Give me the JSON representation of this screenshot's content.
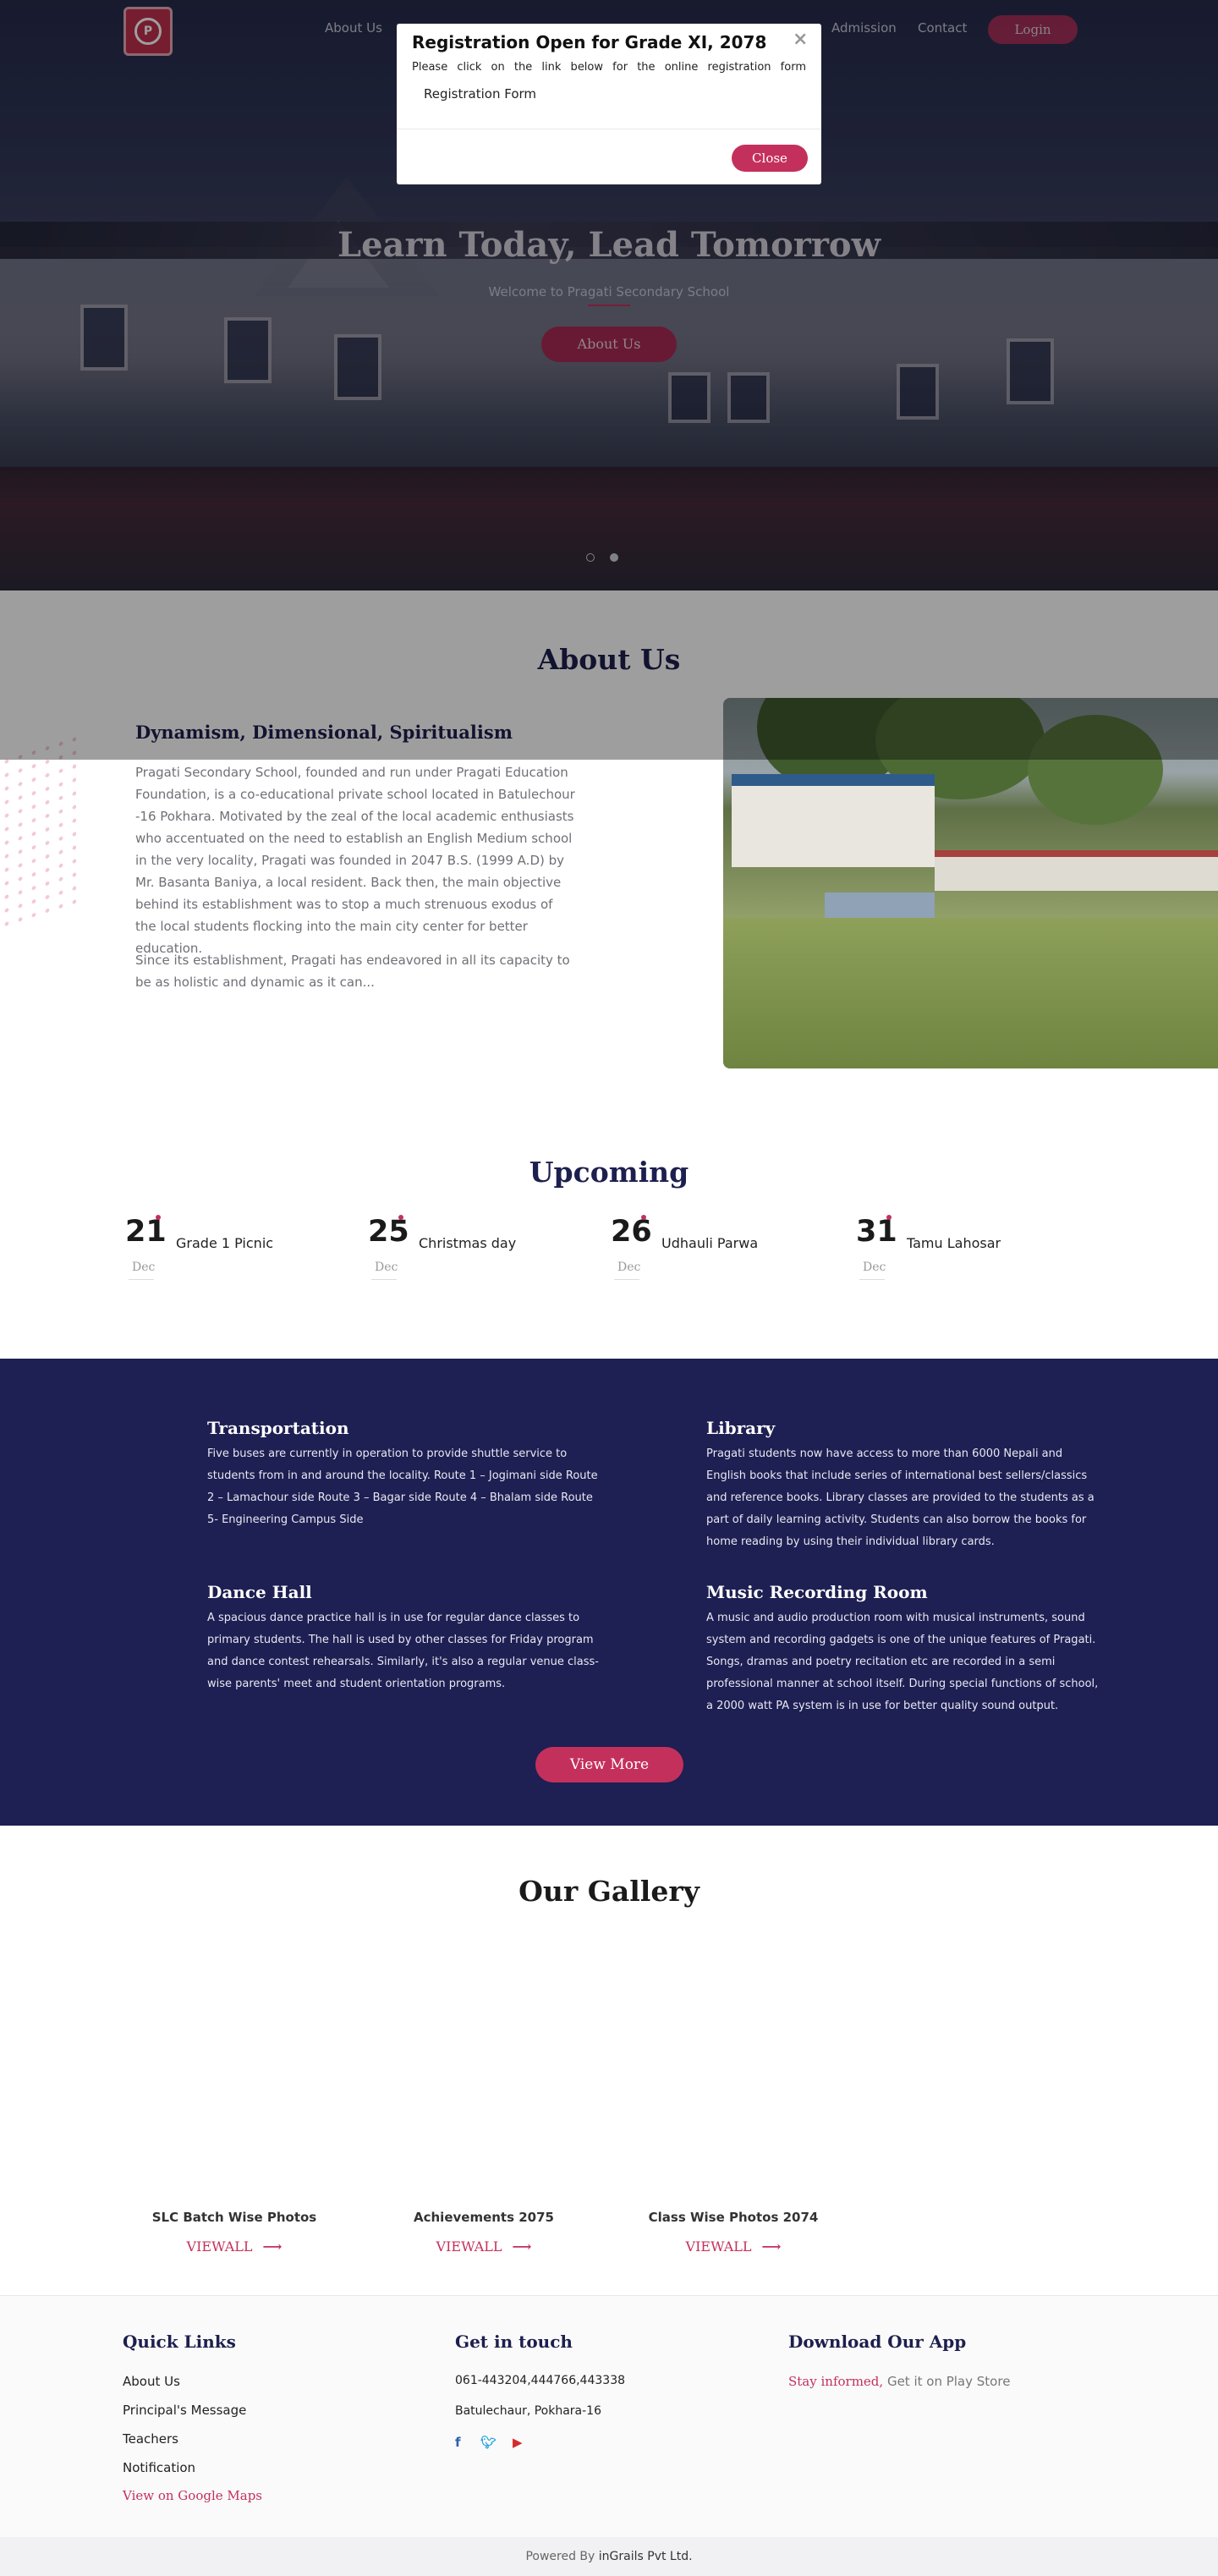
{
  "nav": {
    "links": [
      "About Us",
      "Admission",
      "Contact"
    ],
    "login": "Login"
  },
  "hero": {
    "title": "Learn Today, Lead Tomorrow",
    "subtitle": "Welcome to Pragati Secondary School",
    "button": "About Us"
  },
  "modal": {
    "title": "Registration Open for Grade XI, 2078",
    "close_x": "×",
    "text": "Please click on the link below for the online registration form",
    "link": "Registration Form",
    "close_button": "Close"
  },
  "about": {
    "title": "About Us",
    "subtitle": "Dynamism, Dimensional, Spiritualism",
    "p1": "Pragati Secondary School, founded and run under Pragati Education Foundation, is a co-educational private school located in Batulechour -16 Pokhara. Motivated by the zeal of the local academic enthusiasts who accentuated on the need to establish an English Medium school in the very locality, Pragati was founded in 2047 B.S. (1999 A.D) by Mr. Basanta Baniya, a local resident. Back then, the main objective behind its establishment was to stop a much strenuous exodus of the local students flocking into the main city center for better education.",
    "p2": "Since its establishment, Pragati has endeavored in all its capacity to be as holistic and dynamic as it can..."
  },
  "upcoming": {
    "title": "Upcoming",
    "events": [
      {
        "day": "21",
        "month": "Dec",
        "name": "Grade 1 Picnic"
      },
      {
        "day": "25",
        "month": "Dec",
        "name": "Christmas day"
      },
      {
        "day": "26",
        "month": "Dec",
        "name": "Udhauli Parwa"
      },
      {
        "day": "31",
        "month": "Dec",
        "name": "Tamu Lahosar"
      }
    ]
  },
  "facilities": {
    "items": [
      {
        "title": "Transportation",
        "text": "Five buses are currently in operation to provide shuttle service to students from in and around the locality. Route 1 – Jogimani side Route 2 – Lamachour side Route 3 – Bagar side Route 4 – Bhalam side Route 5- Engineering Campus Side"
      },
      {
        "title": "Library",
        "text": "Pragati students now have access to more than 6000 Nepali and English books that include series of international best sellers/classics and reference books. Library classes are provided to the students as a part of daily learning activity. Students can also borrow the books for home reading by using their individual library cards."
      },
      {
        "title": "Dance Hall",
        "text": "A spacious dance practice hall is in use for regular dance classes to primary students. The hall is used by other classes for Friday program and dance contest rehearsals. Similarly, it's also a regular venue class-wise parents' meet and student orientation programs."
      },
      {
        "title": "Music Recording Room",
        "text": "A music and audio production room with musical instruments, sound system and recording gadgets is one of the unique features of Pragati. Songs, dramas and poetry recitation etc are recorded in a semi professional manner at school itself. During special functions of school, a 2000 watt PA system is in use for better quality sound output."
      }
    ],
    "button": "View More"
  },
  "gallery": {
    "title": "Our Gallery",
    "albums": [
      {
        "name": "SLC Batch Wise Photos",
        "link": "VIEWALL"
      },
      {
        "name": "Achievements 2075",
        "link": "VIEWALL"
      },
      {
        "name": "Class Wise Photos 2074",
        "link": "VIEWALL"
      }
    ]
  },
  "footer": {
    "quick_links": {
      "title": "Quick Links",
      "items": [
        "About Us",
        "Principal's Message",
        "Teachers",
        "Notification"
      ],
      "maps": "View on Google Maps"
    },
    "contact": {
      "title": "Get in touch",
      "phone": "061-443204,444766,443338",
      "address": "Batulechaur, Pokhara-16",
      "social": [
        "facebook-icon",
        "twitter-icon",
        "youtube-icon"
      ]
    },
    "app": {
      "title": "Download Our App",
      "highlight": "Stay informed,",
      "text": "Get it on Play Store"
    },
    "powered_prefix": "Powered By",
    "powered_by": "inGrails Pvt Ltd."
  },
  "colors": {
    "primary": "#1e1f52",
    "accent": "#c4305c"
  }
}
